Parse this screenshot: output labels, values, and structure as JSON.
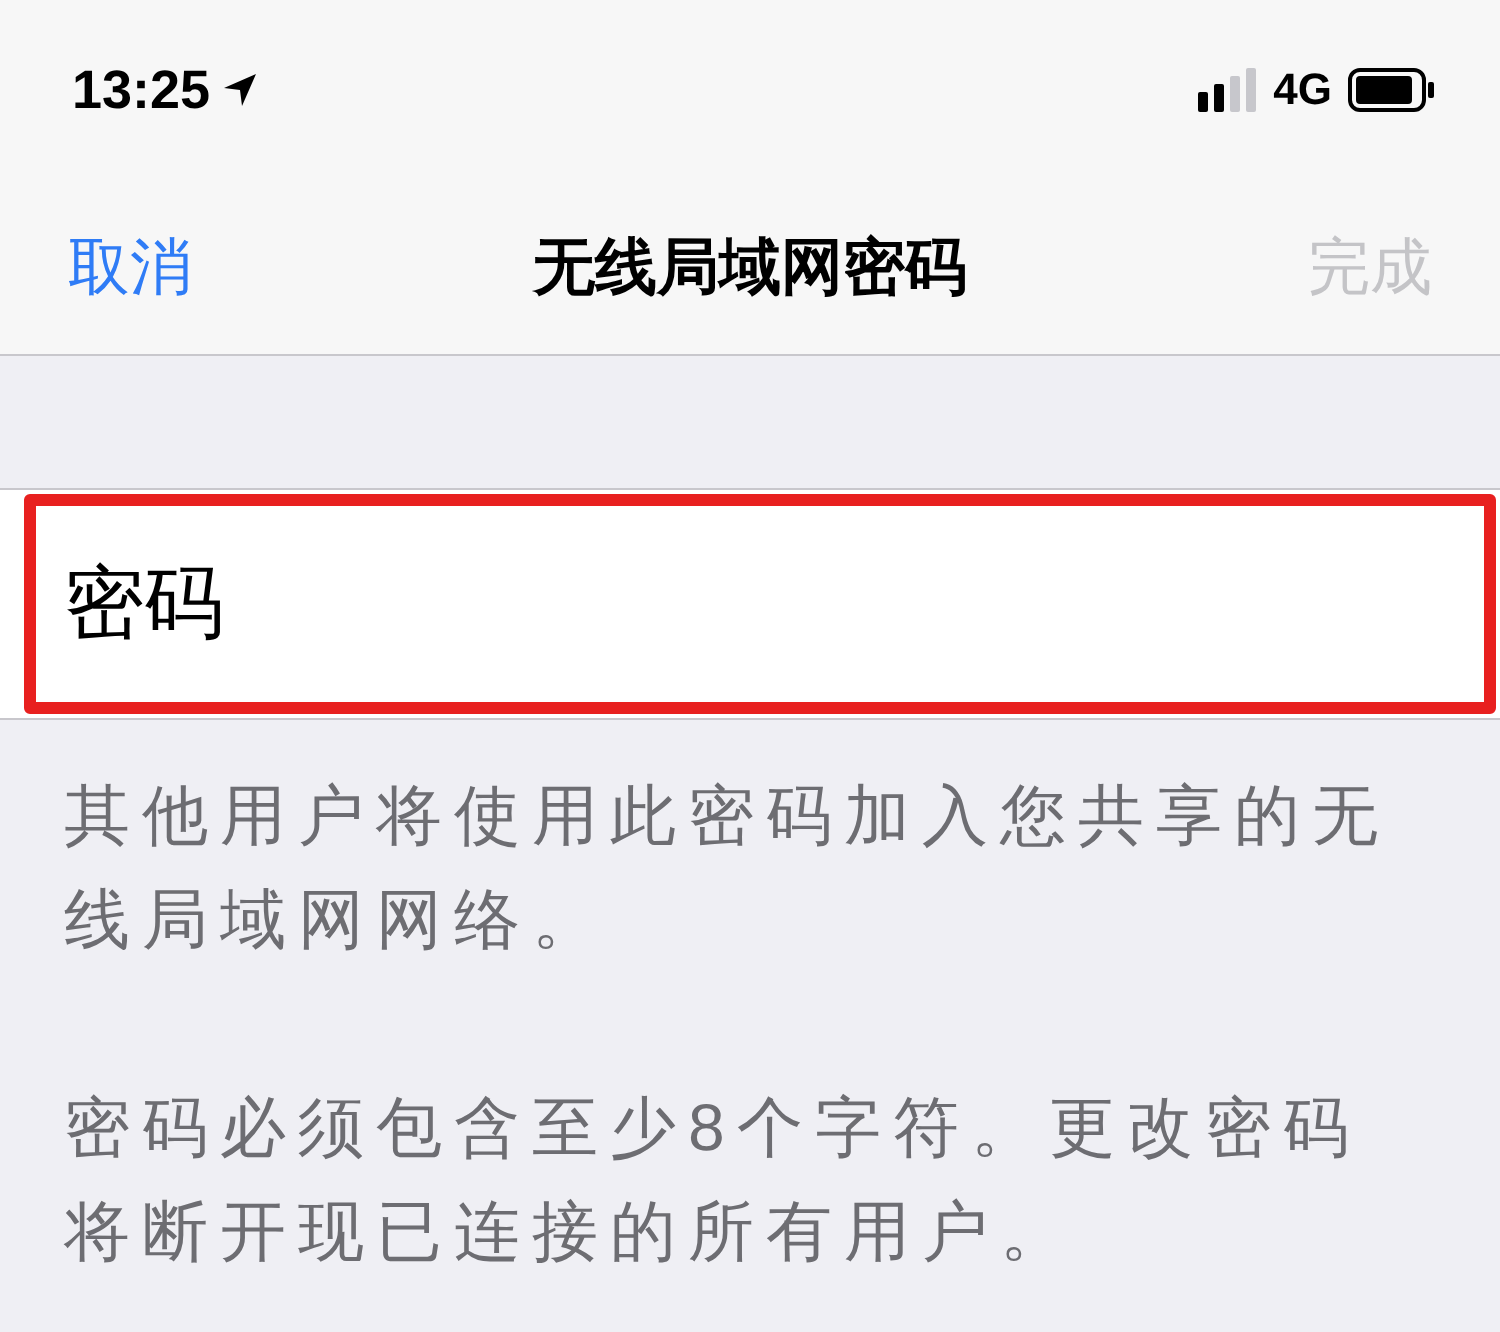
{
  "status_bar": {
    "time": "13:25",
    "network": "4G"
  },
  "nav": {
    "cancel": "取消",
    "title": "无线局域网密码",
    "done": {
      "label": "完成",
      "disabled": true
    }
  },
  "password_field": {
    "placeholder": "密码",
    "highlighted": true
  },
  "footer_notes": [
    "其他用户将使用此密码加入您共享的无线局域网网络。",
    "密码必须包含至少8个字符。更改密码将断开现已连接的所有用户。"
  ]
}
